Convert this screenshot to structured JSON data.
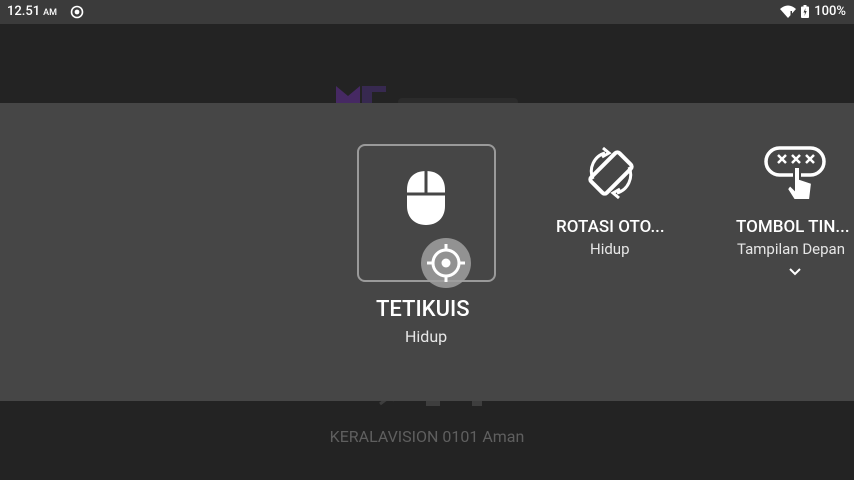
{
  "status_bar": {
    "time": "12.51",
    "ampm": "AM",
    "battery": "100%",
    "icons": [
      "sync-icon",
      "wifi-icon",
      "battery-charging-icon"
    ]
  },
  "background": {
    "network_text": "KERALAVISION 0101 Aman"
  },
  "tiles": [
    {
      "icon": "mouse-icon",
      "title": "TETIKUIS",
      "status": "Hidup",
      "focused": true
    },
    {
      "icon": "screen-rotation-icon",
      "title": "ROTASI OTO...",
      "status": "Hidup"
    },
    {
      "icon": "touch-buttons-icon",
      "title": "TOMBOL TIN...",
      "status": "Tampilan Depan",
      "expandable": true
    }
  ],
  "colors": {
    "panel": "#464646",
    "background": "#232323",
    "statusbar": "#3b3b3b",
    "logo": "#6a2aa0"
  }
}
